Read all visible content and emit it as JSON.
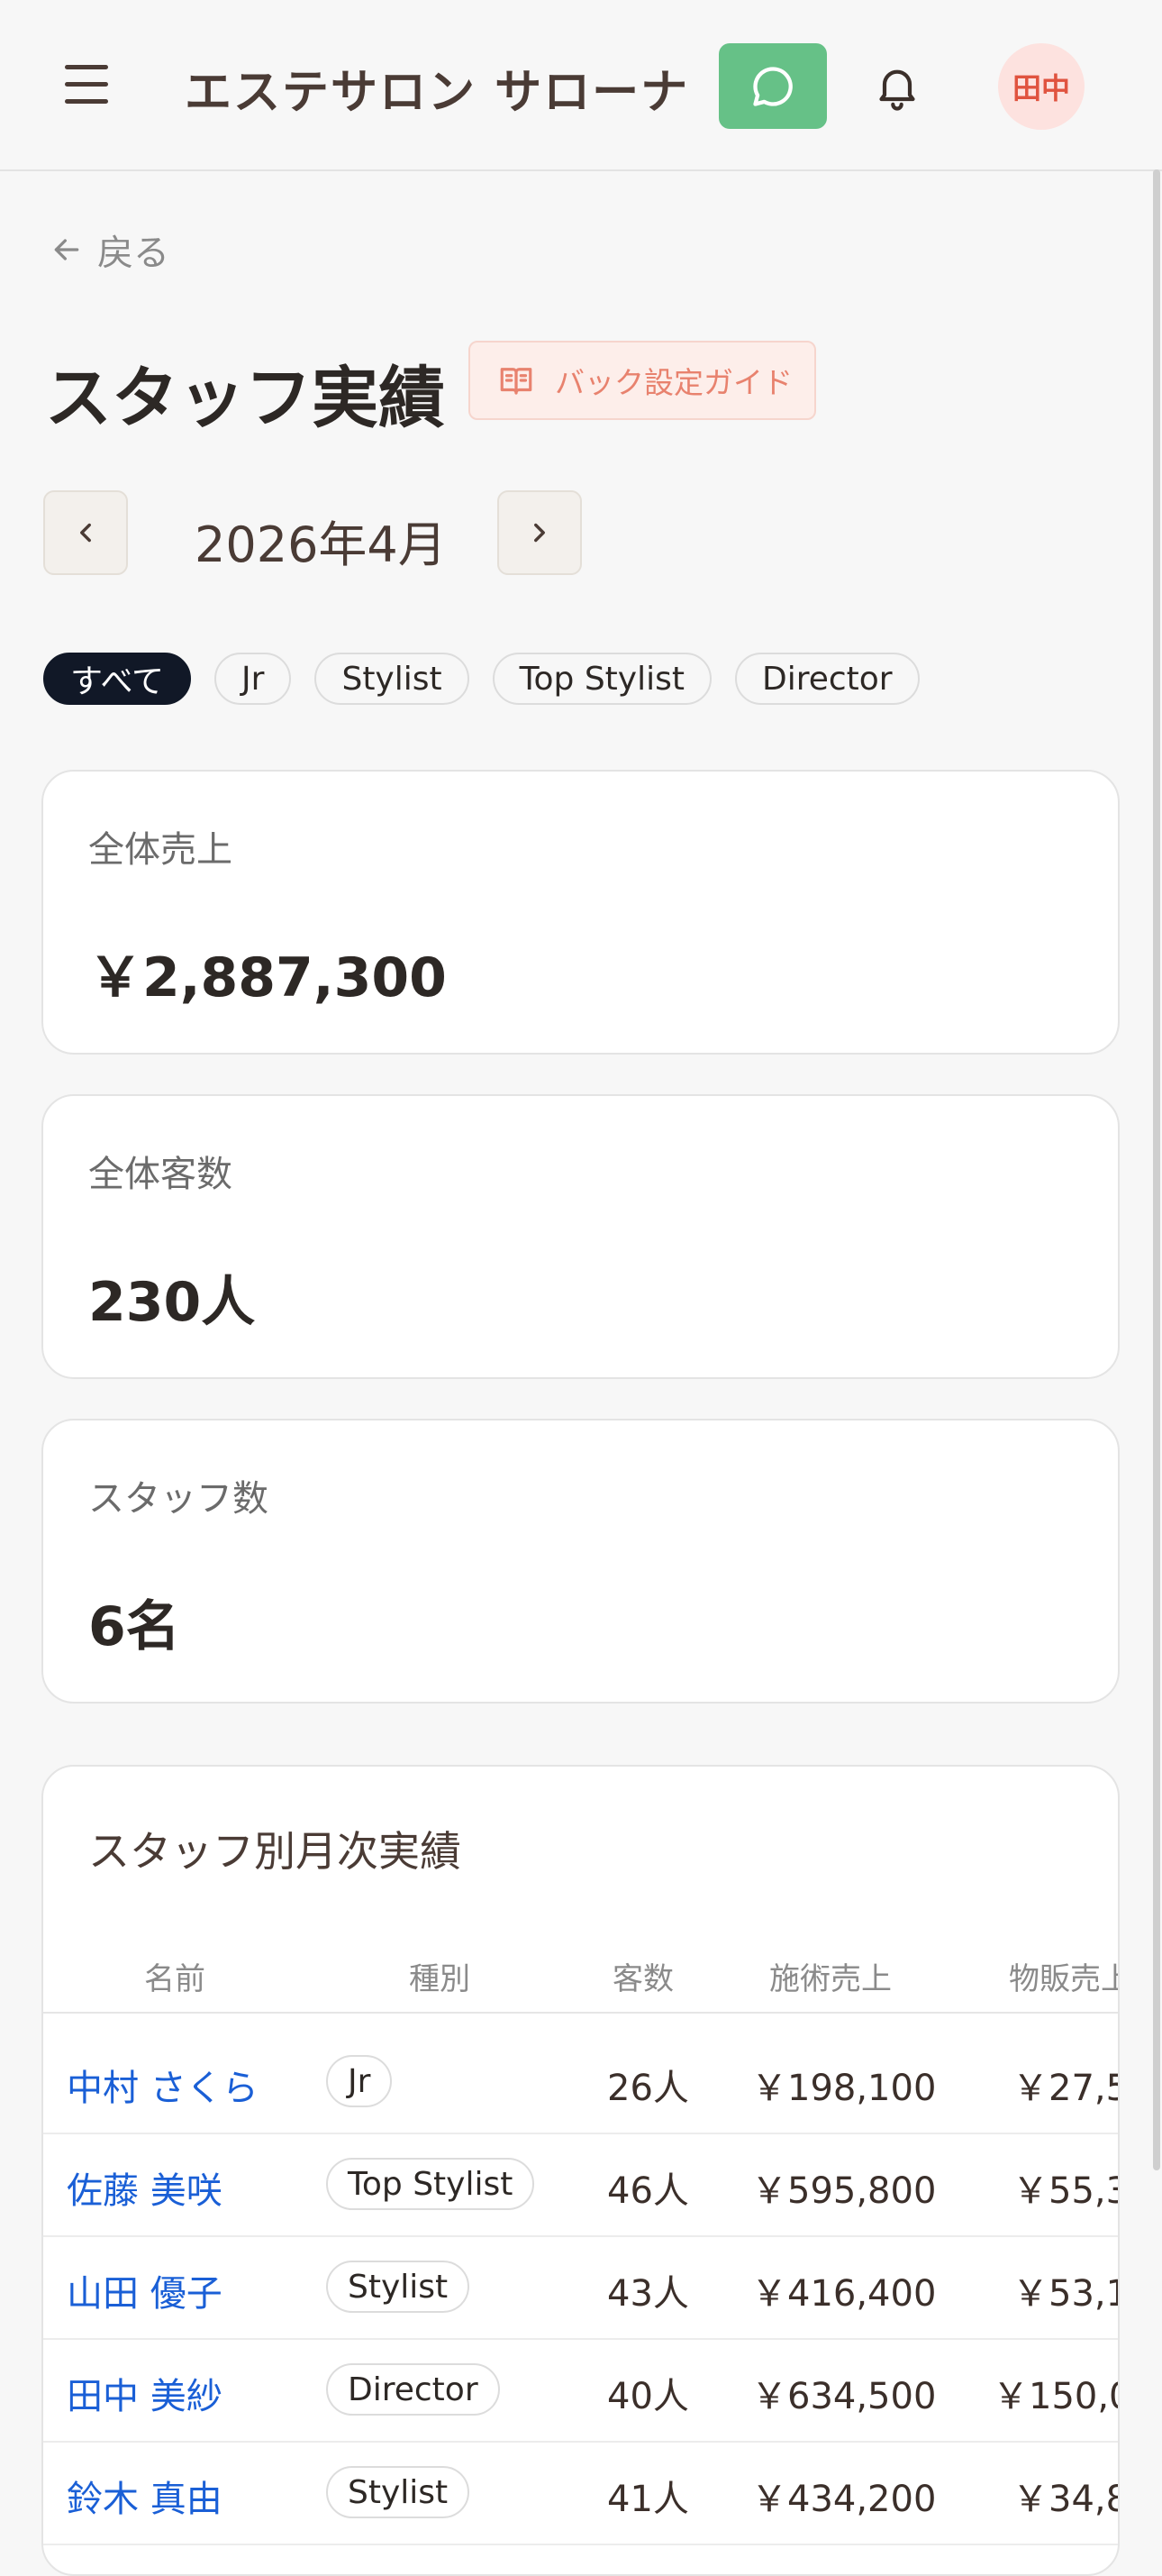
{
  "header": {
    "title": "エステサロン サローナ",
    "avatar_initials": "田中"
  },
  "nav": {
    "back_label": "戻る"
  },
  "page": {
    "title": "スタッフ実績",
    "guide_label": "バック設定ガイド",
    "month": "2026年4月"
  },
  "filters": [
    "すべて",
    "Jr",
    "Stylist",
    "Top Stylist",
    "Director"
  ],
  "stats": {
    "total_sales_label": "全体売上",
    "total_sales_value": "￥2,887,300",
    "total_customers_label": "全体客数",
    "total_customers_value": "230人",
    "staff_count_label": "スタッフ数",
    "staff_count_value": "6名"
  },
  "table": {
    "title": "スタッフ別月次実績",
    "headers": [
      "名前",
      "種別",
      "客数",
      "施術売上",
      "物販売上"
    ],
    "rows": [
      {
        "name": "中村 さくら",
        "role": "Jr",
        "customers": "26人",
        "service": "￥198,100",
        "product": "￥27,5"
      },
      {
        "name": "佐藤 美咲",
        "role": "Top Stylist",
        "customers": "46人",
        "service": "￥595,800",
        "product": "￥55,3"
      },
      {
        "name": "山田 優子",
        "role": "Stylist",
        "customers": "43人",
        "service": "￥416,400",
        "product": "￥53,1"
      },
      {
        "name": "田中 美紗",
        "role": "Director",
        "customers": "40人",
        "service": "￥634,500",
        "product": "￥150,0"
      },
      {
        "name": "鈴木 真由",
        "role": "Stylist",
        "customers": "41人",
        "service": "￥434,200",
        "product": "￥34,8"
      }
    ]
  },
  "colors": {
    "accent_green": "#66c187",
    "link_blue": "#1a5fd6",
    "guide_orange": "#e8826e",
    "active_chip": "#111827"
  }
}
